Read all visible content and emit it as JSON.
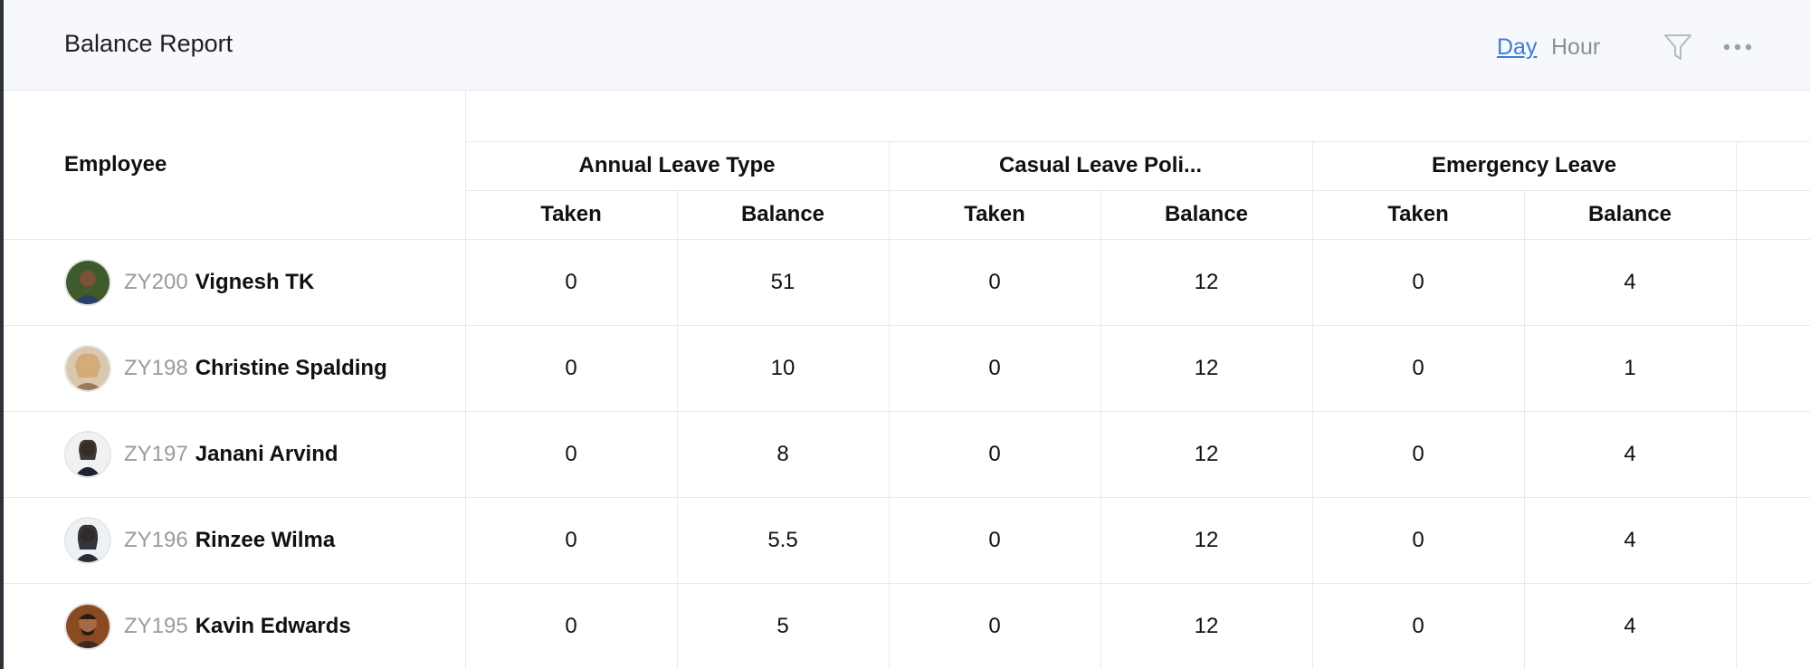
{
  "header": {
    "title": "Balance Report",
    "toggle": {
      "day": "Day",
      "hour": "Hour",
      "selected": "Day"
    },
    "icons": {
      "filter": "filter-icon",
      "more": "more-icon"
    }
  },
  "table": {
    "employee_header": "Employee",
    "leave_types": [
      {
        "name": "Annual Leave Type",
        "taken_label": "Taken",
        "balance_label": "Balance"
      },
      {
        "name": "Casual Leave Poli...",
        "taken_label": "Taken",
        "balance_label": "Balance"
      },
      {
        "name": "Emergency Leave",
        "taken_label": "Taken",
        "balance_label": "Balance"
      }
    ],
    "rows": [
      {
        "id": "ZY200",
        "name": "Vignesh TK",
        "values": [
          "0",
          "51",
          "0",
          "12",
          "0",
          "4"
        ]
      },
      {
        "id": "ZY198",
        "name": "Christine Spalding",
        "values": [
          "0",
          "10",
          "0",
          "12",
          "0",
          "1"
        ]
      },
      {
        "id": "ZY197",
        "name": "Janani Arvind",
        "values": [
          "0",
          "8",
          "0",
          "12",
          "0",
          "4"
        ]
      },
      {
        "id": "ZY196",
        "name": "Rinzee Wilma",
        "values": [
          "0",
          "5.5",
          "0",
          "12",
          "0",
          "4"
        ]
      },
      {
        "id": "ZY195",
        "name": "Kavin Edwards",
        "values": [
          "0",
          "5",
          "0",
          "12",
          "0",
          "4"
        ]
      }
    ]
  },
  "colors": {
    "accent": "#3f7bd8",
    "muted": "#8a8f96",
    "header_bg": "#f6f8fb",
    "grid_line": "#e7e9ec"
  }
}
